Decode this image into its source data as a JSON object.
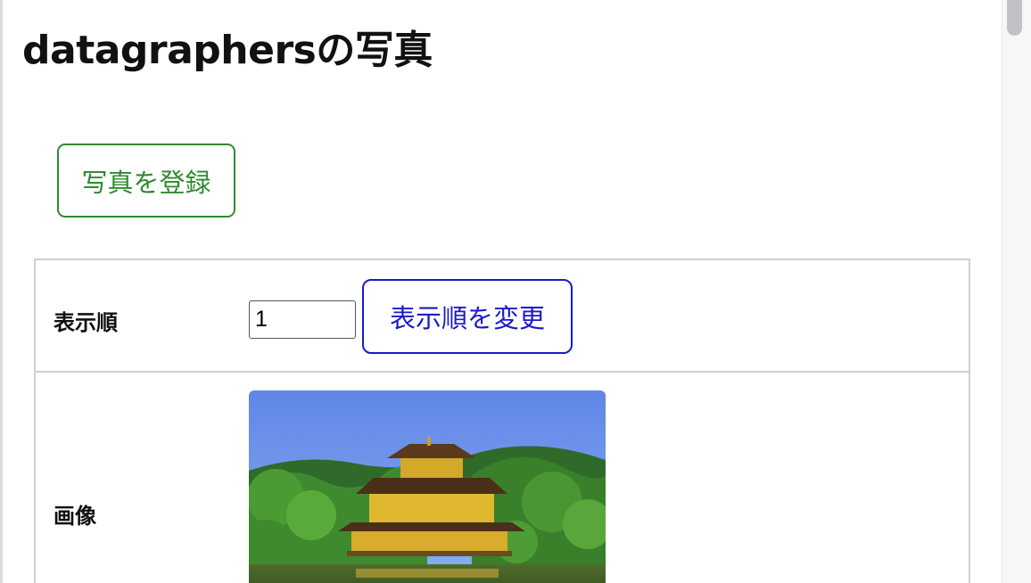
{
  "page": {
    "title": "datagraphersの写真"
  },
  "actions": {
    "register_label": "写真を登録"
  },
  "detail": {
    "order_label": "表示順",
    "order_value": "1",
    "change_order_label": "表示順を変更",
    "image_label": "画像"
  },
  "icons": {
    "photo": "temple-photo"
  },
  "colors": {
    "register_accent": "#2f8a2f",
    "change_order_accent": "#1a1acc",
    "table_border": "#cfcfcf"
  }
}
